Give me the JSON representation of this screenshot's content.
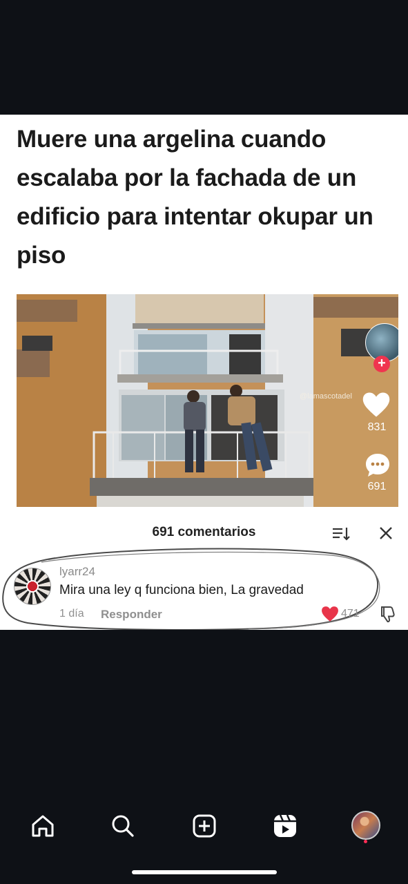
{
  "post": {
    "headline": "Muere una argelina cuando escalaba por la fachada de un edificio para intentar okupar un piso"
  },
  "video_overlay": {
    "watermark": "@lamascotadel",
    "likes": "831",
    "comments": "691",
    "follow_glyph": "+"
  },
  "comments_panel": {
    "title": "691 comentarios",
    "sort_icon": "sort-icon",
    "close_icon": "close-icon"
  },
  "comment": {
    "username": "lyarr24",
    "text": "Mira una ley q funciona bien, La gravedad",
    "time": "1 día",
    "reply_label": "Responder",
    "likes": "471",
    "like_color": "#e8354a"
  },
  "bottom_nav": {
    "items": [
      "home-icon",
      "search-icon",
      "create-icon",
      "reels-icon",
      "profile-avatar"
    ]
  }
}
